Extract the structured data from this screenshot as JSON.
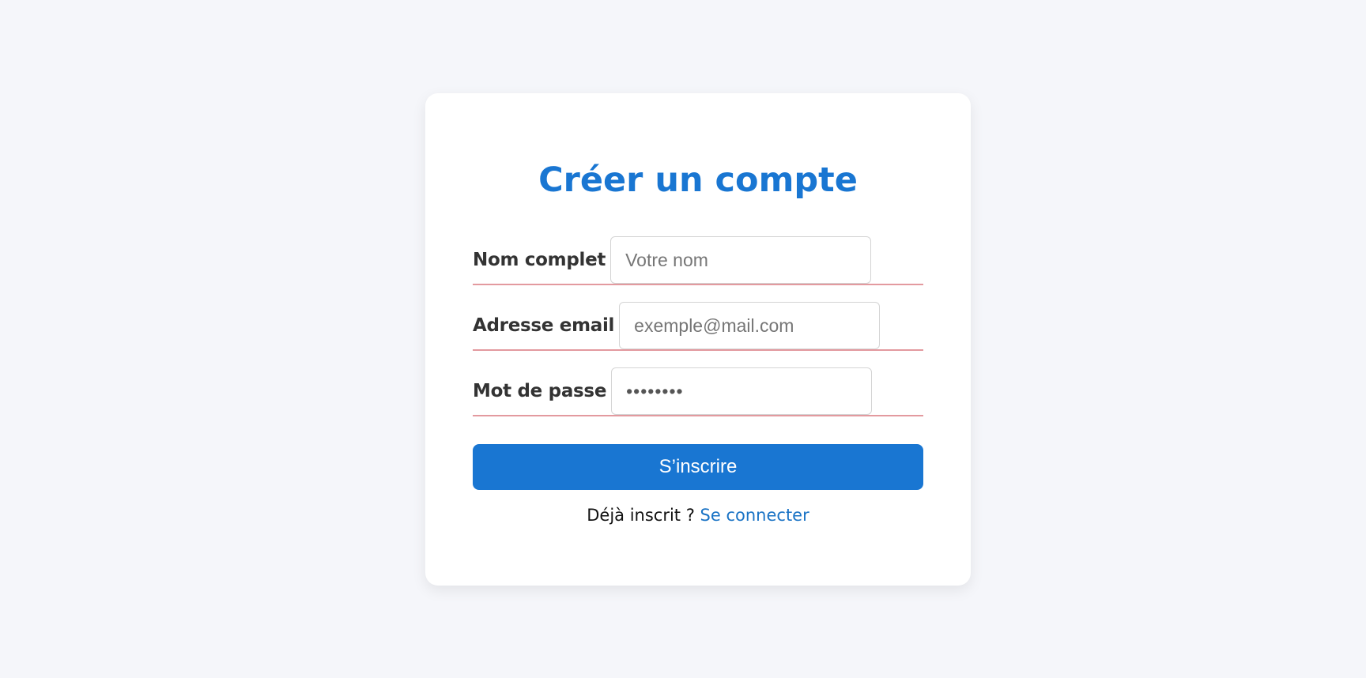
{
  "form": {
    "title": "Créer un compte",
    "fields": [
      {
        "label": "Nom complet",
        "placeholder": "Votre nom",
        "value": ""
      },
      {
        "label": "Adresse email",
        "placeholder": "exemple@mail.com",
        "value": ""
      },
      {
        "label": "Mot de passe",
        "placeholder": "",
        "value": "password"
      }
    ],
    "submit_label": "S’inscrire",
    "login_prompt": "Déjà inscrit ?",
    "login_link": "Se connecter"
  },
  "colors": {
    "accent": "#1976d2",
    "field_underline": "#e39a9f",
    "background": "#f5f6fa"
  }
}
